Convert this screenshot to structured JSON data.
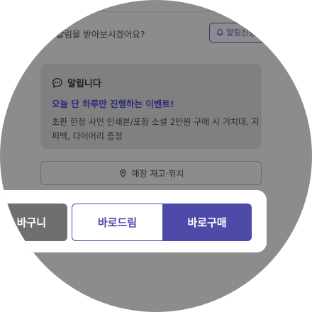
{
  "alerts": {
    "kakao_prompt": "ok 알림을 받아보시겠어요?",
    "notify_button_label": "알림신청"
  },
  "notice": {
    "title": "알립니다",
    "event_title": "오늘 단 하루만 진행하는 이벤트!",
    "event_description": "초판 한정 사인 인쇄본/포함 소설 2만원 구매 시 거치대, 지퍼백, 다이어리 증정"
  },
  "store": {
    "label": "매장 재고·위치"
  },
  "actions": {
    "cart_label": "바구니",
    "dream_label": "바로드림",
    "buy_label": "바로구매"
  },
  "colors": {
    "brand_purple": "#4e4aa8",
    "notice_title_purple": "#2a2a78",
    "overlay_gray": "#8c8c8c"
  }
}
